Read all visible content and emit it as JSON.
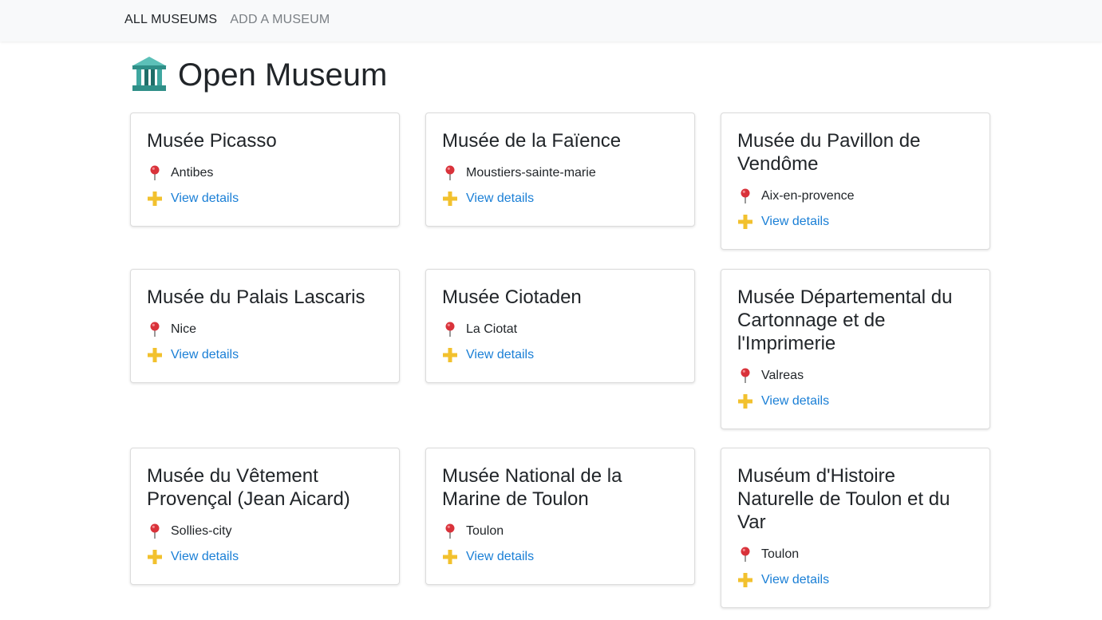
{
  "nav": {
    "items": [
      {
        "label": "ALL MUSEUMS",
        "active": true
      },
      {
        "label": "ADD A MUSEUM",
        "active": false
      }
    ]
  },
  "header": {
    "title": "Open Museum",
    "icon": "museum-icon"
  },
  "museums": [
    {
      "name": "Musée Picasso",
      "city": "Antibes",
      "link": "View details"
    },
    {
      "name": "Musée de la Faïence",
      "city": "Moustiers-sainte-marie",
      "link": "View details"
    },
    {
      "name": "Musée du Pavillon de Vendôme",
      "city": "Aix-en-provence",
      "link": "View details"
    },
    {
      "name": "Musée du Palais Lascaris",
      "city": "Nice",
      "link": "View details"
    },
    {
      "name": "Musée Ciotaden",
      "city": "La Ciotat",
      "link": "View details"
    },
    {
      "name": "Musée Départemental du Cartonnage et de l'Imprimerie",
      "city": "Valreas",
      "link": "View details"
    },
    {
      "name": "Musée du Vêtement Provençal (Jean Aicard)",
      "city": "Sollies-city",
      "link": "View details"
    },
    {
      "name": "Musée National de la Marine de Toulon",
      "city": "Toulon",
      "link": "View details"
    },
    {
      "name": "Muséum d'Histoire Naturelle de Toulon et du Var",
      "city": "Toulon",
      "link": "View details"
    }
  ],
  "colors": {
    "link": "#1a7fd6",
    "pin": "#d9323a",
    "plus": "#f2c12e",
    "museum_icon": "#3fa7a0"
  },
  "icons": {
    "location": "round-pushpin-icon",
    "details": "plus-icon"
  }
}
